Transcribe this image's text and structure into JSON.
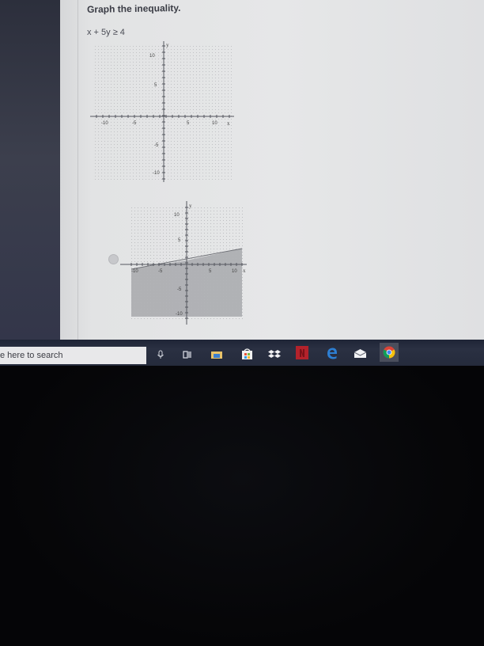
{
  "question": {
    "title": "Graph the inequality.",
    "inequality": "x + 5y ≥ 4"
  },
  "graph_empty": {
    "axis_x_label": "x",
    "axis_y_label": "y",
    "ticks": {
      "y10": "10",
      "y5": "5",
      "yneg5": "-5",
      "yneg10": "-10",
      "xneg10": "-10",
      "xneg5": "-5",
      "x5": "5",
      "x10": "10"
    }
  },
  "graph_option": {
    "axis_x_label": "x",
    "axis_y_label": "y",
    "ticks": {
      "y10": "10",
      "y5": "5",
      "yneg5": "-5",
      "yneg10": "-10",
      "xneg10": "-10",
      "xneg5": "-5",
      "x5": "5",
      "x10": "10"
    },
    "shading": "below line",
    "shade_color": "#a7a8ab"
  },
  "taskbar": {
    "search_text": "e here to search",
    "icons": [
      "microphone-icon",
      "task-view-icon",
      "file-explorer-icon",
      "store-icon",
      "dropbox-icon",
      "netflix-icon",
      "edge-icon",
      "mail-icon",
      "chrome-icon"
    ]
  },
  "colors": {
    "taskbar": "#252b3c",
    "netflix": "#b3222b",
    "edge": "#2d7fd3",
    "accent_blue": "#3b8fe0"
  }
}
